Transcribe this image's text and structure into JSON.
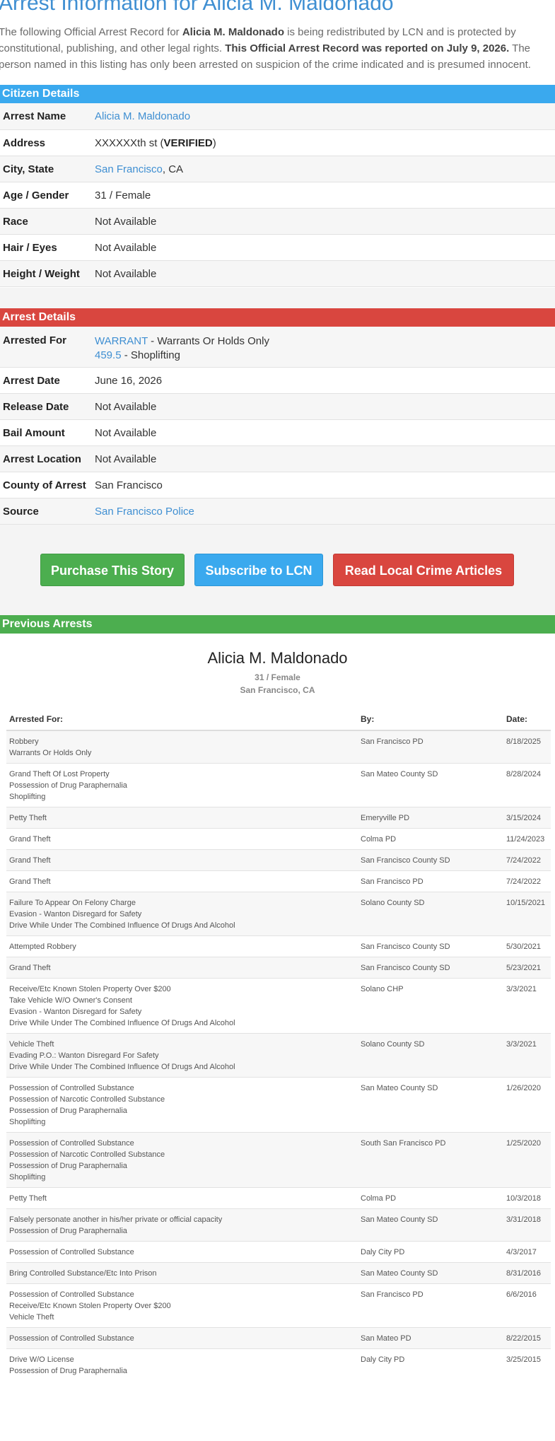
{
  "title_prefix": "Arrest Information for ",
  "name": "Alicia M. Maldonado",
  "intro": {
    "p1": "The following Official Arrest Record for ",
    "p2": " is being redistributed by LCN and is protected by constitutional, publishing, and other legal rights. ",
    "reported": "This Official Arrest Record was reported on July 9, 2026.",
    "p3": " The person named in this listing has only been arrested on suspicion of the crime indicated and is presumed innocent."
  },
  "colors": {
    "blue": "#3aa9ee",
    "red": "#d9463f",
    "green": "#4cae4f",
    "link": "#3f8fd2"
  },
  "citizen": {
    "header": "Citizen Details",
    "labels": {
      "name": "Arrest Name",
      "address": "Address",
      "city": "City, State",
      "age": "Age / Gender",
      "race": "Race",
      "hair": "Hair / Eyes",
      "height": "Height / Weight"
    },
    "name": "Alicia M. Maldonado",
    "address": "XXXXXXth st (",
    "address_flag": "VERIFIED",
    "address_close": ")",
    "city": "San Francisco",
    "state": ", CA",
    "age_gender": "31 / Female",
    "race": "Not Available",
    "hair_eyes": "Not Available",
    "height_weight": "Not Available"
  },
  "arrest": {
    "header": "Arrest Details",
    "labels": {
      "for": "Arrested For",
      "date": "Arrest Date",
      "release": "Release Date",
      "bail": "Bail Amount",
      "location": "Arrest Location",
      "county": "County of Arrest",
      "source": "Source"
    },
    "charge1_code": "WARRANT",
    "charge1_desc": " - Warrants Or Holds Only",
    "charge2_code": "459.5",
    "charge2_desc": " - Shoplifting",
    "date": "June 16, 2026",
    "release": "Not Available",
    "bail": "Not Available",
    "location": "Not Available",
    "county": "San Francisco",
    "source": "San Francisco Police"
  },
  "buttons": {
    "purchase": "Purchase This Story",
    "subscribe": "Subscribe to LCN",
    "articles": "Read Local Crime Articles"
  },
  "previous": {
    "header": "Previous Arrests",
    "name": "Alicia M. Maldonado",
    "age_gender": "31 / Female",
    "city": "San Francisco, CA",
    "columns": {
      "charges": "Arrested For:",
      "by": "By:",
      "date": "Date:"
    },
    "rows": [
      {
        "charges": [
          "Robbery",
          "Warrants Or Holds Only"
        ],
        "by": "San Francisco PD",
        "date": "8/18/2025"
      },
      {
        "charges": [
          "Grand Theft Of Lost Property",
          "Possession of Drug Paraphernalia",
          "Shoplifting"
        ],
        "by": "San Mateo County SD",
        "date": "8/28/2024"
      },
      {
        "charges": [
          "Petty Theft"
        ],
        "by": "Emeryville PD",
        "date": "3/15/2024"
      },
      {
        "charges": [
          "Grand Theft"
        ],
        "by": "Colma PD",
        "date": "11/24/2023"
      },
      {
        "charges": [
          "Grand Theft"
        ],
        "by": "San Francisco County SD",
        "date": "7/24/2022"
      },
      {
        "charges": [
          "Grand Theft"
        ],
        "by": "San Francisco PD",
        "date": "7/24/2022"
      },
      {
        "charges": [
          "Failure To Appear On Felony Charge",
          "Evasion - Wanton Disregard for Safety",
          "Drive While Under The Combined Influence Of Drugs And Alcohol"
        ],
        "by": "Solano County SD",
        "date": "10/15/2021"
      },
      {
        "charges": [
          "Attempted Robbery"
        ],
        "by": "San Francisco County SD",
        "date": "5/30/2021"
      },
      {
        "charges": [
          "Grand Theft"
        ],
        "by": "San Francisco County SD",
        "date": "5/23/2021"
      },
      {
        "charges": [
          "Receive/Etc Known Stolen Property Over $200",
          "Take Vehicle W/O Owner's Consent",
          "Evasion - Wanton Disregard for Safety",
          "Drive While Under The Combined Influence Of Drugs And Alcohol"
        ],
        "by": "Solano CHP",
        "date": "3/3/2021"
      },
      {
        "charges": [
          "Vehicle Theft",
          "Evading P.O.: Wanton Disregard For Safety",
          "Drive While Under The Combined Influence Of Drugs And Alcohol"
        ],
        "by": "Solano County SD",
        "date": "3/3/2021"
      },
      {
        "charges": [
          "Possession of Controlled Substance",
          "Possession of Narcotic Controlled Substance",
          "Possession of Drug Paraphernalia",
          "Shoplifting"
        ],
        "by": "San Mateo County SD",
        "date": "1/26/2020"
      },
      {
        "charges": [
          "Possession of Controlled Substance",
          "Possession of Narcotic Controlled Substance",
          "Possession of Drug Paraphernalia",
          "Shoplifting"
        ],
        "by": "South San Francisco PD",
        "date": "1/25/2020"
      },
      {
        "charges": [
          "Petty Theft"
        ],
        "by": "Colma PD",
        "date": "10/3/2018"
      },
      {
        "charges": [
          "Falsely personate another in his/her private or official capacity",
          "Possession of Drug Paraphernalia"
        ],
        "by": "San Mateo County SD",
        "date": "3/31/2018"
      },
      {
        "charges": [
          "Possession of Controlled Substance"
        ],
        "by": "Daly City PD",
        "date": "4/3/2017"
      },
      {
        "charges": [
          "Bring Controlled Substance/Etc Into Prison"
        ],
        "by": "San Mateo County SD",
        "date": "8/31/2016"
      },
      {
        "charges": [
          "Possession of Controlled Substance",
          "Receive/Etc Known Stolen Property Over $200",
          "Vehicle Theft"
        ],
        "by": "San Francisco PD",
        "date": "6/6/2016"
      },
      {
        "charges": [
          "Possession of Controlled Substance"
        ],
        "by": "San Mateo PD",
        "date": "8/22/2015"
      },
      {
        "charges": [
          "Drive W/O License",
          "Possession of Drug Paraphernalia"
        ],
        "by": "Daly City PD",
        "date": "3/25/2015"
      }
    ]
  }
}
